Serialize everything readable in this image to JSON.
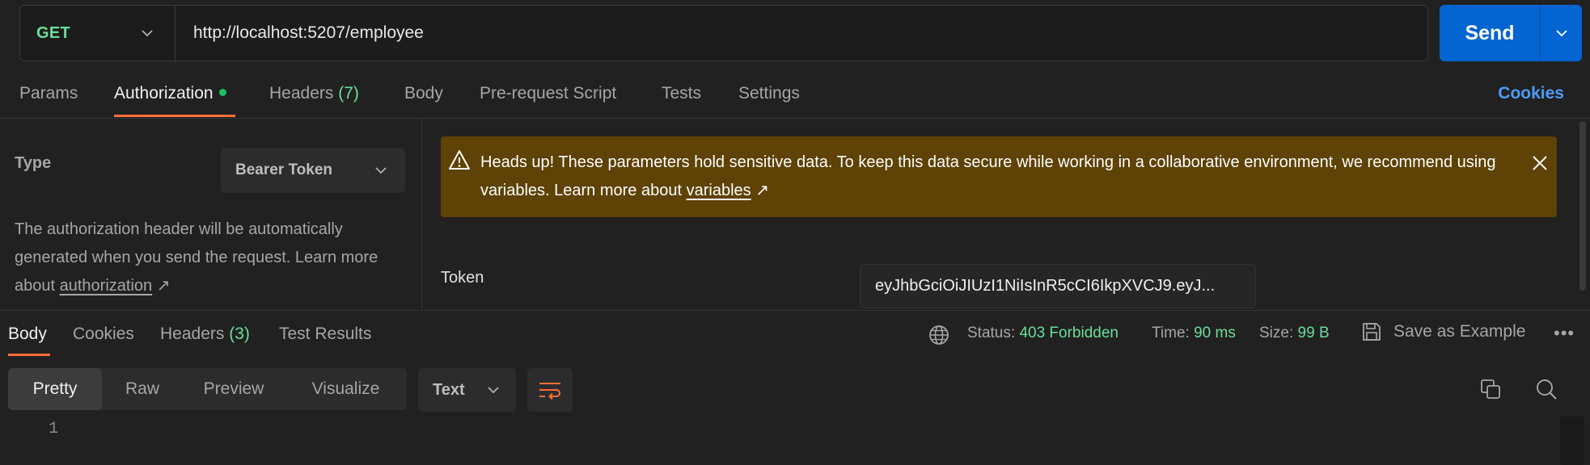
{
  "request": {
    "method": "GET",
    "url": "http://localhost:5207/employee",
    "send_label": "Send"
  },
  "request_tabs": {
    "params": "Params",
    "authorization": "Authorization",
    "headers": "Headers",
    "headers_count": "(7)",
    "body": "Body",
    "prerequest": "Pre-request Script",
    "tests": "Tests",
    "settings": "Settings",
    "cookies": "Cookies"
  },
  "auth": {
    "type_label": "Type",
    "type_value": "Bearer Token",
    "desc_prefix": "The authorization header will be automatically generated when you send the request. Learn more about ",
    "desc_link": "authorization",
    "desc_suffix": " ↗",
    "warning_prefix": "Heads up! These parameters hold sensitive data. To keep this data secure while working in a collaborative environment, we recommend using variables. Learn more about ",
    "warning_link": "variables",
    "warning_suffix": " ↗",
    "token_label": "Token",
    "token_value": "eyJhbGciOiJIUzI1NiIsInR5cCI6IkpXVCJ9.eyJ..."
  },
  "response_tabs": {
    "body": "Body",
    "cookies": "Cookies",
    "headers": "Headers",
    "headers_count": "(3)",
    "test_results": "Test Results"
  },
  "response_meta": {
    "status_label": "Status:",
    "status_value": "403 Forbidden",
    "time_label": "Time:",
    "time_value": "90 ms",
    "size_label": "Size:",
    "size_value": "99 B",
    "save_example": "Save as Example",
    "more": "•••"
  },
  "response_view": {
    "modes": [
      "Pretty",
      "Raw",
      "Preview",
      "Visualize"
    ],
    "active_mode": "Pretty",
    "format": "Text",
    "line_numbers": [
      "1"
    ]
  },
  "colors": {
    "accent": "#ff6c37",
    "send": "#0265d2",
    "success_text": "#6bdd9a",
    "warning_bg": "#5e4206",
    "link": "#4d9cf8"
  }
}
